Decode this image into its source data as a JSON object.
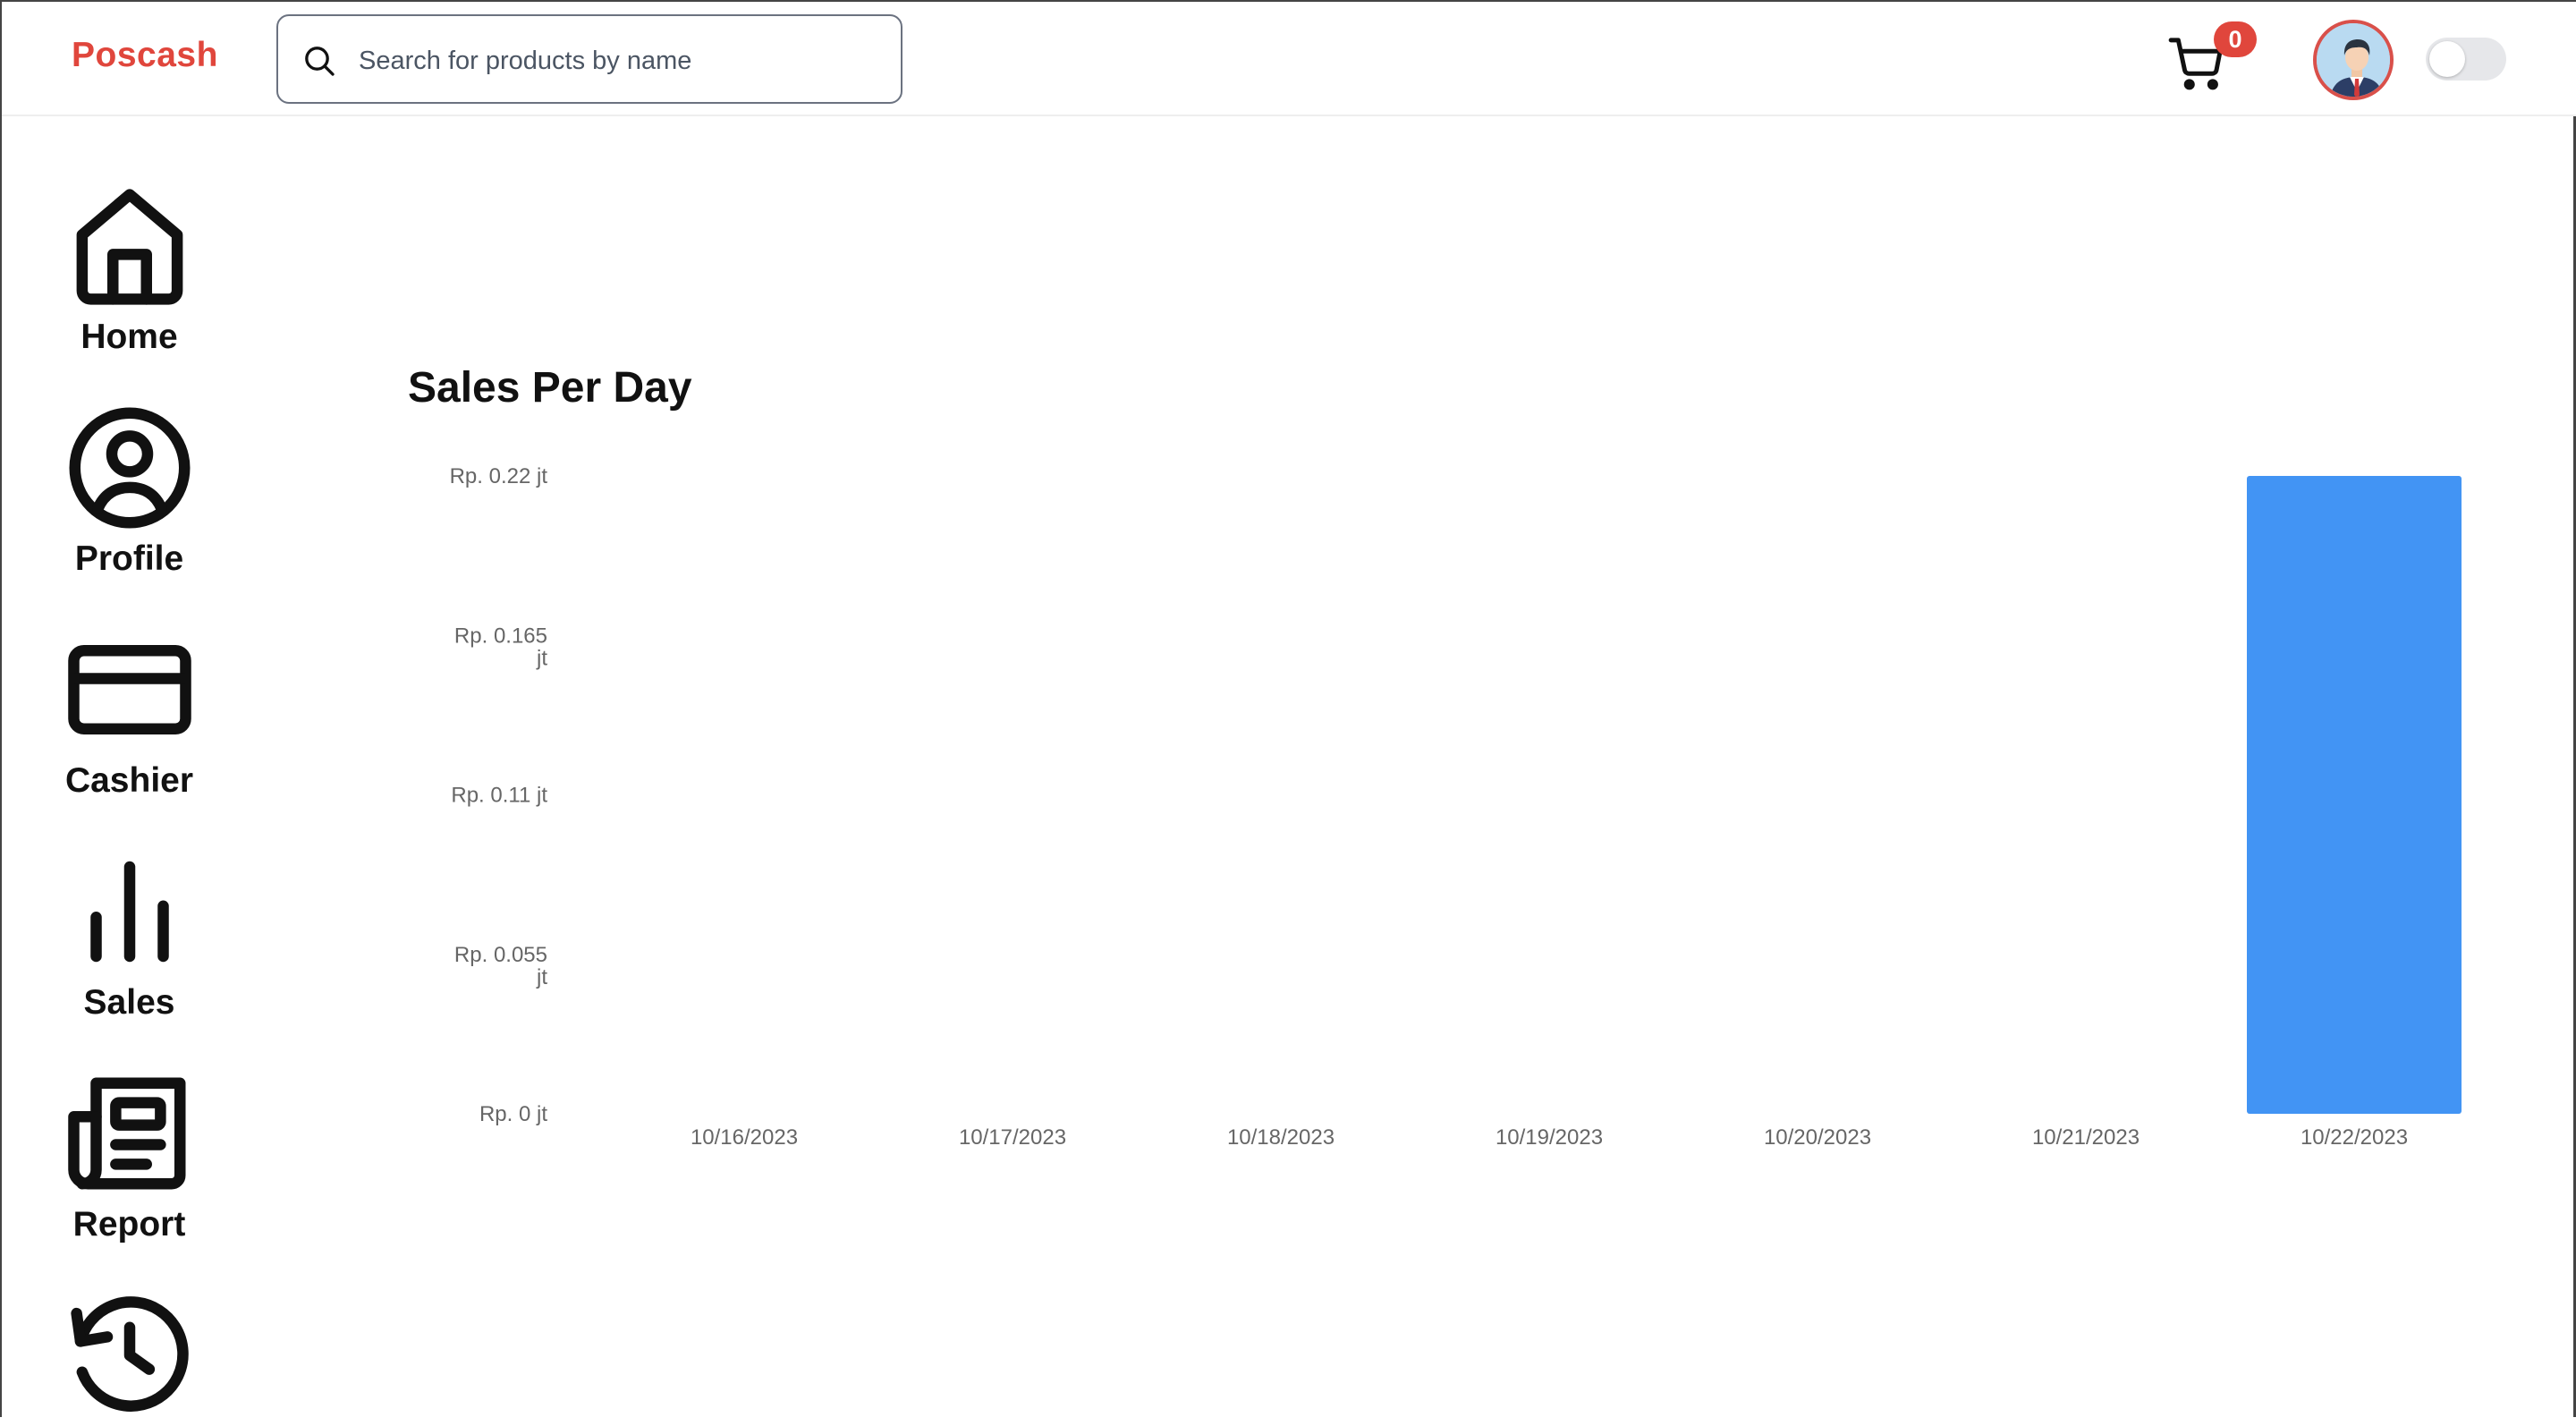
{
  "app": {
    "title": "Poscash"
  },
  "search": {
    "placeholder": "Search for products by name",
    "value": ""
  },
  "header": {
    "cart_count": "0",
    "theme_toggle": "off"
  },
  "sidebar": {
    "items": [
      {
        "label": "Home",
        "icon": "home-icon"
      },
      {
        "label": "Profile",
        "icon": "user-circle-icon"
      },
      {
        "label": "Cashier",
        "icon": "credit-card-icon"
      },
      {
        "label": "Sales",
        "icon": "bar-chart-icon"
      },
      {
        "label": "Report",
        "icon": "newspaper-icon"
      },
      {
        "label": "",
        "icon": "history-icon"
      }
    ]
  },
  "main": {
    "title": "Sales Per Day"
  },
  "colors": {
    "brand": "#e0463c",
    "bar": "#4294f4",
    "badge": "#e0463c"
  },
  "chart_data": {
    "type": "bar",
    "title": "Sales Per Day",
    "xlabel": "",
    "ylabel": "",
    "categories": [
      "10/16/2023",
      "10/17/2023",
      "10/18/2023",
      "10/19/2023",
      "10/20/2023",
      "10/21/2023",
      "10/22/2023"
    ],
    "values": [
      0,
      0,
      0,
      0,
      0,
      0,
      0.22
    ],
    "ylim": [
      0,
      0.22
    ],
    "yticks": [
      0,
      0.055,
      0.11,
      0.165,
      0.22
    ],
    "ytick_labels": [
      "Rp. 0 jt",
      "Rp. 0.055 jt",
      "Rp. 0.11 jt",
      "Rp. 0.165 jt",
      "Rp. 0.22 jt"
    ],
    "grid": false,
    "legend": "none"
  }
}
